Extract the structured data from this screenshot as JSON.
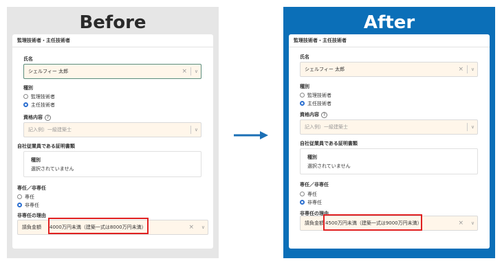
{
  "before": {
    "title": "Before",
    "section_title": "監理技術者・主任技術者",
    "name_label": "氏名",
    "name_value": "シェルフィー 太郎",
    "type_label": "種別",
    "type_options": [
      "監理技術者",
      "主任技術者"
    ],
    "type_selected": "主任技術者",
    "qual_label": "資格内容",
    "qual_placeholder": "記入例）一級建築士",
    "cert_section": "自社従業員である証明書類",
    "cert_type_label": "種別",
    "cert_type_value": "選択されていません",
    "dedication_label": "専任／非専任",
    "dedication_options": [
      "専任",
      "非専任"
    ],
    "dedication_selected": "非専任",
    "reason_label": "非専任の理由",
    "reason_prefix": "請負金額",
    "reason_value": "4000万円未満（建築一式は8000万円未満）"
  },
  "after": {
    "title": "After",
    "section_title": "監理技術者・主任技術者",
    "name_label": "氏名",
    "name_value": "シェルフィー 太郎",
    "type_label": "種別",
    "type_options": [
      "監理技術者",
      "主任技術者"
    ],
    "type_selected": "主任技術者",
    "qual_label": "資格内容",
    "qual_placeholder": "記入例）一級建築士",
    "cert_section": "自社従業員である証明書類",
    "cert_type_label": "種別",
    "cert_type_value": "選択されていません",
    "dedication_label": "専任／非専任",
    "dedication_options": [
      "専任",
      "非専任"
    ],
    "dedication_selected": "非専任",
    "reason_label": "非専任の理由",
    "reason_prefix": "請負金額",
    "reason_value": "4500万円未満（建築一式は9000万円未満）"
  },
  "icons": {
    "clear": "×",
    "chevron": "∨",
    "help": "?"
  },
  "colors": {
    "before_bg": "#e6e6e6",
    "after_bg": "#0b6fb8",
    "highlight": "#e02020",
    "arrow": "#1b6fb5",
    "field_bg": "#fff6ea"
  }
}
